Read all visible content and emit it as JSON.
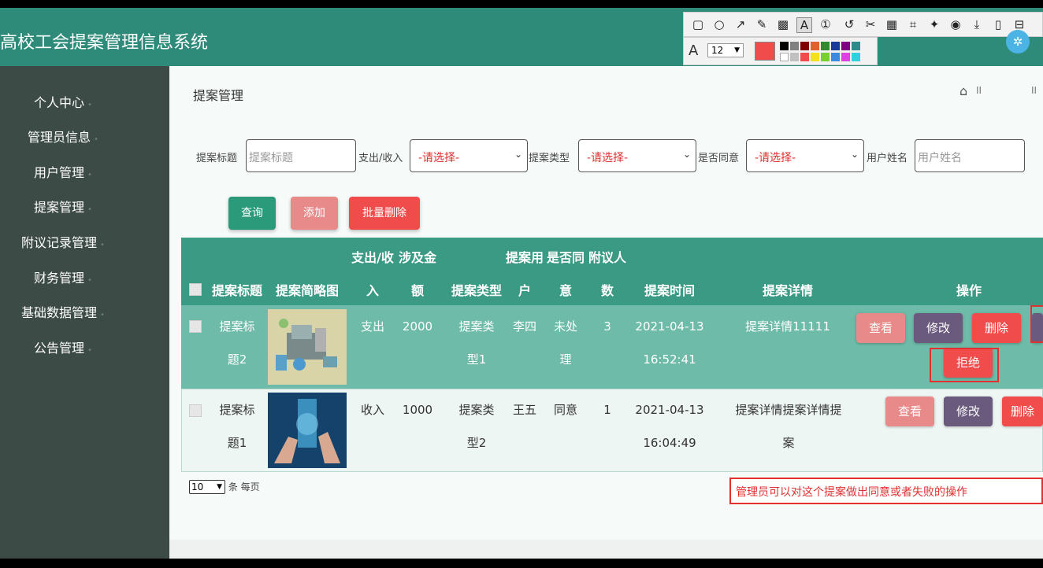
{
  "app": {
    "title": "高校工会提案管理信息系统"
  },
  "sidebar": {
    "items": [
      {
        "label": "个人中心"
      },
      {
        "label": "管理员信息"
      },
      {
        "label": "用户管理"
      },
      {
        "label": "提案管理"
      },
      {
        "label": "附议记录管理"
      },
      {
        "label": "财务管理"
      },
      {
        "label": "基础数据管理"
      },
      {
        "label": "公告管理"
      }
    ]
  },
  "page": {
    "title": "提案管理"
  },
  "filters": {
    "title_label": "提案标题",
    "title_placeholder": "提案标题",
    "inout_label": "支出/收入",
    "inout_value": "-请选择-",
    "type_label": "提案类型",
    "type_value": "-请选择-",
    "agree_label": "是否同意",
    "agree_value": "-请选择-",
    "user_label": "用户姓名",
    "user_placeholder": "用户姓名"
  },
  "actions": {
    "query": "查询",
    "add": "添加",
    "batch_delete": "批量删除"
  },
  "table": {
    "headers": {
      "title": "提案标题",
      "image": "提案简略图",
      "inout_top": "支出/收",
      "inout_bottom": "入",
      "amount_top": "涉及金",
      "amount_bottom": "额",
      "type": "提案类型",
      "user_top": "提案用",
      "user_bottom": "户",
      "agree_top": "是否同",
      "agree_bottom": "意",
      "count_top": "附议人",
      "count_bottom": "数",
      "time": "提案时间",
      "detail": "提案详情",
      "ops": "操作"
    },
    "rows": [
      {
        "title_l1": "提案标",
        "title_l2": "题2",
        "inout": "支出",
        "amount": "2000",
        "type_l1": "提案类",
        "type_l2": "型1",
        "user": "李四",
        "agree_l1": "未处",
        "agree_l2": "理",
        "count": "3",
        "time_l1": "2021-04-13",
        "time_l2": "16:52:41",
        "detail_l1": "提案详情11111",
        "detail_l2": "",
        "view": "查看",
        "edit": "修改",
        "delete": "删除",
        "reject": "拒绝"
      },
      {
        "title_l1": "提案标",
        "title_l2": "题1",
        "inout": "收入",
        "amount": "1000",
        "type_l1": "提案类",
        "type_l2": "型2",
        "user": "王五",
        "agree_l1": "同意",
        "agree_l2": "",
        "count": "1",
        "time_l1": "2021-04-13",
        "time_l2": "16:04:49",
        "detail_l1": "提案详情提案详情提",
        "detail_l2": "案",
        "view": "查看",
        "edit": "修改",
        "delete": "删除"
      }
    ]
  },
  "pager": {
    "page_size": "10",
    "suffix": "条 每页"
  },
  "annotation": {
    "text": "管理员可以对这个提案做出同意或者失败的操作"
  },
  "annotator": {
    "font_size": "12",
    "font_label": "A"
  },
  "colors": {
    "header": "#2e8b7a",
    "sidebar": "#3d4b47",
    "query": "#2a9a7a",
    "add": "#e88a8a",
    "delete": "#f14c4c",
    "edit": "#6a5a7e",
    "annotation": "#e03030"
  },
  "icons": {
    "home": "home-icon",
    "share": "share-icon"
  }
}
